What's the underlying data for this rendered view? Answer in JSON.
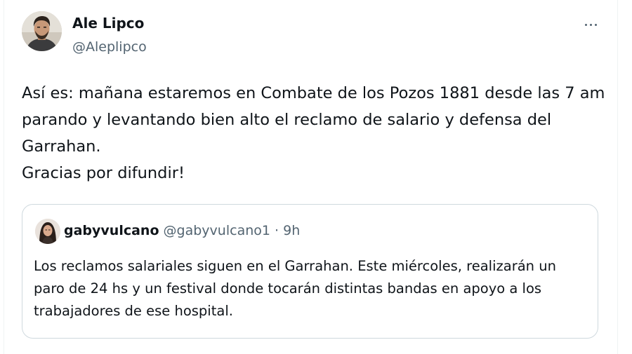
{
  "tweet": {
    "author": {
      "name": "Ale Lipco",
      "handle": "@Aleplipco"
    },
    "more_icon": "more-horizontal-icon",
    "text_lines": [
      "Así es: mañana estaremos en Combate de los Pozos 1881 desde las 7 am",
      "parando y levantando bien alto el reclamo de salario y defensa del",
      "Garrahan.",
      "Gracias por difundir!"
    ]
  },
  "quote": {
    "author_name": "gabyvulcano",
    "author_handle": "@gabyvulcano1",
    "separator": "·",
    "time": "9h",
    "text_lines": [
      "Los reclamos salariales siguen en el Garrahan. Este miércoles, realizarán un",
      "paro de 24 hs y un festival donde tocarán distintas bandas en apoyo a los",
      "trabajadores de ese hospital."
    ]
  },
  "colors": {
    "primary_text": "#0f1419",
    "secondary_text": "#536471",
    "border": "#cfd9de"
  }
}
